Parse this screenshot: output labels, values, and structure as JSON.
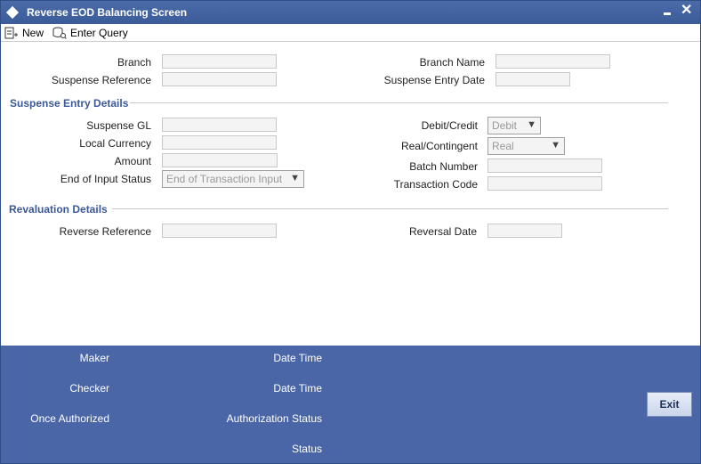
{
  "window": {
    "title": "Reverse EOD Balancing Screen"
  },
  "toolbar": {
    "new_label": "New",
    "enter_query_label": "Enter Query"
  },
  "form": {
    "branch_label": "Branch",
    "branch_value": "",
    "suspense_reference_label": "Suspense Reference",
    "suspense_reference_value": "",
    "branch_name_label": "Branch Name",
    "branch_name_value": "",
    "suspense_entry_date_label": "Suspense Entry Date",
    "suspense_entry_date_value": ""
  },
  "suspense_entry": {
    "section_title": "Suspense Entry Details",
    "suspense_gl_label": "Suspense GL",
    "local_currency_label": "Local Currency",
    "amount_label": "Amount",
    "end_of_input_status_label": "End of Input Status",
    "end_of_input_status_value": "End of Transaction Input",
    "debit_credit_label": "Debit/Credit",
    "debit_credit_value": "Debit",
    "real_contingent_label": "Real/Contingent",
    "real_contingent_value": "Real",
    "batch_number_label": "Batch Number",
    "transaction_code_label": "Transaction Code"
  },
  "revaluation": {
    "section_title": "Revaluation Details",
    "reverse_reference_label": "Reverse Reference",
    "reversal_date_label": "Reversal Date"
  },
  "footer": {
    "maker_label": "Maker",
    "maker_datetime_label": "Date Time",
    "checker_label": "Checker",
    "checker_datetime_label": "Date Time",
    "once_authorized_label": "Once Authorized",
    "authorization_status_label": "Authorization Status",
    "status_label": "Status",
    "exit_label": "Exit"
  },
  "colors": {
    "titlebar": "#3b5c98",
    "footer": "#4a66a6",
    "section": "#3b5998"
  }
}
